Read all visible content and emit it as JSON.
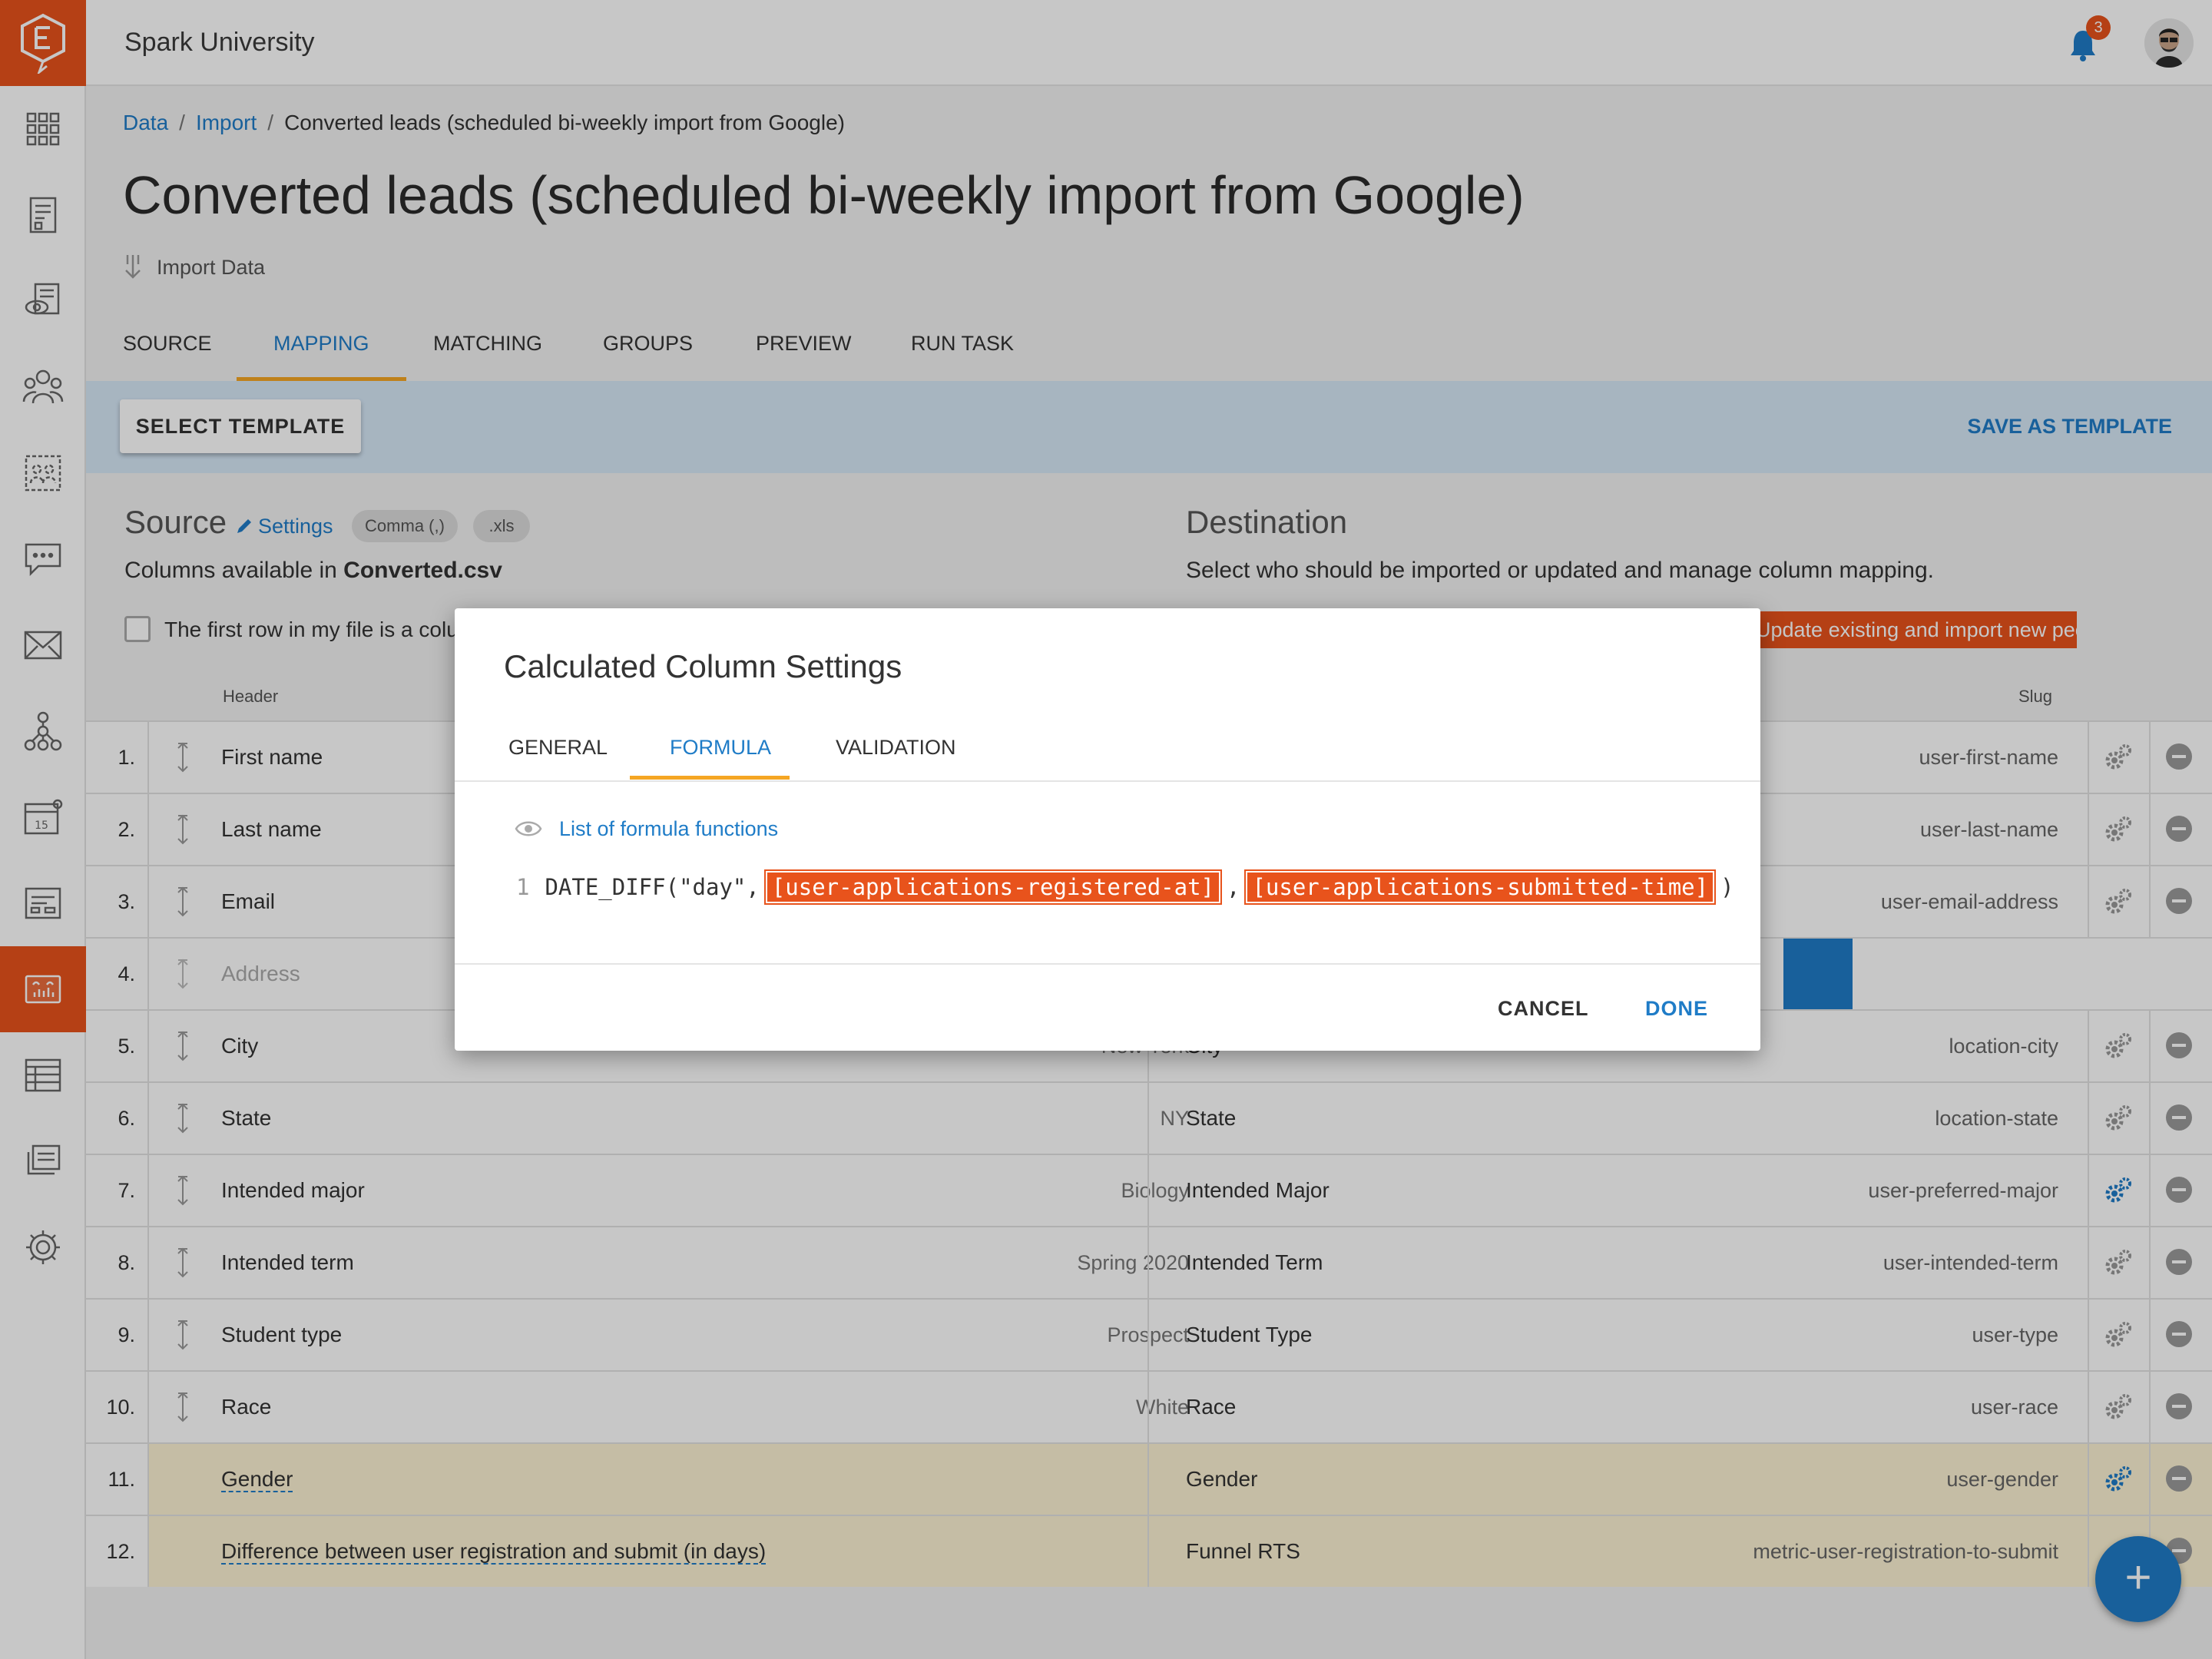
{
  "app": {
    "title": "Spark University",
    "notification_count": "3"
  },
  "sidebar": {
    "items": [
      {
        "icon": "apps-grid-icon"
      },
      {
        "icon": "form-document-icon"
      },
      {
        "icon": "review-eye-icon"
      },
      {
        "icon": "people-group-icon"
      },
      {
        "icon": "segments-icon"
      },
      {
        "icon": "messages-icon"
      },
      {
        "icon": "email-icon"
      },
      {
        "icon": "workflow-icon"
      },
      {
        "icon": "calendar-icon"
      },
      {
        "icon": "dashboard-icon"
      },
      {
        "icon": "data-import-icon",
        "active": true
      },
      {
        "icon": "reports-icon"
      },
      {
        "icon": "files-icon"
      },
      {
        "icon": "settings-gear-icon"
      }
    ],
    "calendar_day": "15"
  },
  "breadcrumb": {
    "items": [
      "Data",
      "Import",
      "Converted leads (scheduled bi-weekly import from Google)"
    ],
    "sep": "/"
  },
  "page": {
    "title": "Converted leads (scheduled bi-weekly import from Google)",
    "subtitle": "Import Data"
  },
  "tabs": [
    "SOURCE",
    "MAPPING",
    "MATCHING",
    "GROUPS",
    "PREVIEW",
    "RUN TASK"
  ],
  "active_tab": "MAPPING",
  "template_bar": {
    "select_label": "SELECT TEMPLATE",
    "save_label": "SAVE AS TEMPLATE"
  },
  "source": {
    "heading": "Source",
    "settings_label": "Settings",
    "pills": [
      "Comma (,)",
      ".xls"
    ],
    "columns_prefix": "Columns available in ",
    "file_name": "Converted.csv",
    "first_row_label": "The first row in my file is a column header"
  },
  "destination": {
    "heading": "Destination",
    "description": "Select who should be imported or updated and manage column mapping.",
    "mode_button": "Update existing and import new people"
  },
  "table_headers": {
    "header": "Header",
    "slug": "Slug"
  },
  "rows": [
    {
      "num": "1.",
      "source": "First name",
      "sample": "",
      "dest": "",
      "slug": "user-first-name"
    },
    {
      "num": "2.",
      "source": "Last name",
      "sample": "",
      "dest": "",
      "slug": "user-last-name"
    },
    {
      "num": "3.",
      "source": "Email",
      "sample": "",
      "dest": "",
      "slug": "user-email-address"
    },
    {
      "num": "4.",
      "source": "Address",
      "sample": "",
      "dest": "",
      "slug": ""
    },
    {
      "num": "5.",
      "source": "City",
      "sample": "New York",
      "dest": "City",
      "slug": "location-city"
    },
    {
      "num": "6.",
      "source": "State",
      "sample": "NY",
      "dest": "State",
      "slug": "location-state"
    },
    {
      "num": "7.",
      "source": "Intended major",
      "sample": "Biology",
      "dest": "Intended Major",
      "slug": "user-preferred-major"
    },
    {
      "num": "8.",
      "source": "Intended term",
      "sample": "Spring 2020",
      "dest": "Intended Term",
      "slug": "user-intended-term"
    },
    {
      "num": "9.",
      "source": "Student type",
      "sample": "Prospect",
      "dest": "Student Type",
      "slug": "user-type"
    },
    {
      "num": "10.",
      "source": "Race",
      "sample": "White",
      "dest": "Race",
      "slug": "user-race"
    },
    {
      "num": "11.",
      "source": "Gender",
      "sample": "",
      "dest": "Gender",
      "slug": "user-gender"
    },
    {
      "num": "12.",
      "source": "Difference between user registration and submit (in days)",
      "sample": "",
      "dest": "Funnel RTS",
      "slug": "metric-user-registration-to-submit"
    }
  ],
  "modal": {
    "title": "Calculated Column Settings",
    "tabs": [
      "GENERAL",
      "FORMULA",
      "VALIDATION"
    ],
    "active_tab": "FORMULA",
    "formula_link": "List of formula functions",
    "line_number": "1",
    "code_prefix": "DATE_DIFF(\"day\",",
    "token1": "[user-applications-registered-at]",
    "comma": ",",
    "token2": "[user-applications-submitted-time]",
    "code_suffix": ")",
    "cancel": "CANCEL",
    "done": "DONE"
  },
  "fab_label": "+",
  "colors": {
    "accent": "#e8531c",
    "link": "#1f7cc7",
    "tab_underline": "#f5a623"
  }
}
